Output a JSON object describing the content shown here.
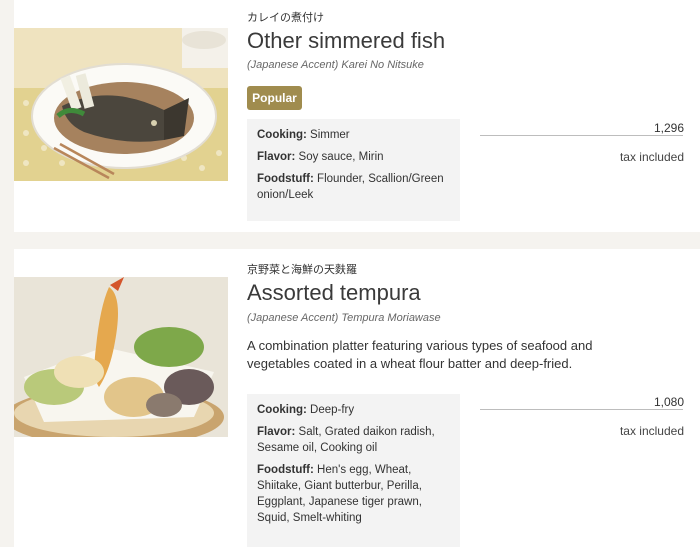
{
  "items": [
    {
      "japanese_name": "カレイの煮付け",
      "name": "Other simmered fish",
      "accent": "(Japanese Accent) Karei No Nitsuke",
      "badge": "Popular",
      "cooking_label": "Cooking:",
      "cooking": "Simmer",
      "flavor_label": "Flavor:",
      "flavor": "Soy sauce, Mirin",
      "foodstuff_label": "Foodstuff:",
      "foodstuff": "Flounder, Scallion/Green onion/Leek",
      "price": "1,296",
      "tax": "tax included",
      "photo_icon": "simmered-fish-photo"
    },
    {
      "japanese_name": "京野菜と海鮮の天麩羅",
      "name": "Assorted tempura",
      "accent": "(Japanese Accent) Tempura Moriawase",
      "description": "A combination platter featuring various types of seafood and vegetables coated in a wheat flour batter and deep-fried.",
      "cooking_label": "Cooking:",
      "cooking": "Deep-fry",
      "flavor_label": "Flavor:",
      "flavor": "Salt, Grated daikon radish, Sesame oil, Cooking oil",
      "foodstuff_label": "Foodstuff:",
      "foodstuff": "Hen's egg, Wheat, Shiitake, Giant butterbur, Perilla, Eggplant, Japanese tiger prawn, Squid, Smelt-whiting",
      "price": "1,080",
      "tax": "tax included",
      "photo_icon": "tempura-photo"
    }
  ],
  "colors": {
    "page_background": "#f5f3ef",
    "card_background": "#ffffff",
    "badge_background": "#a08c4e",
    "spec_background": "#f3f3f3"
  }
}
